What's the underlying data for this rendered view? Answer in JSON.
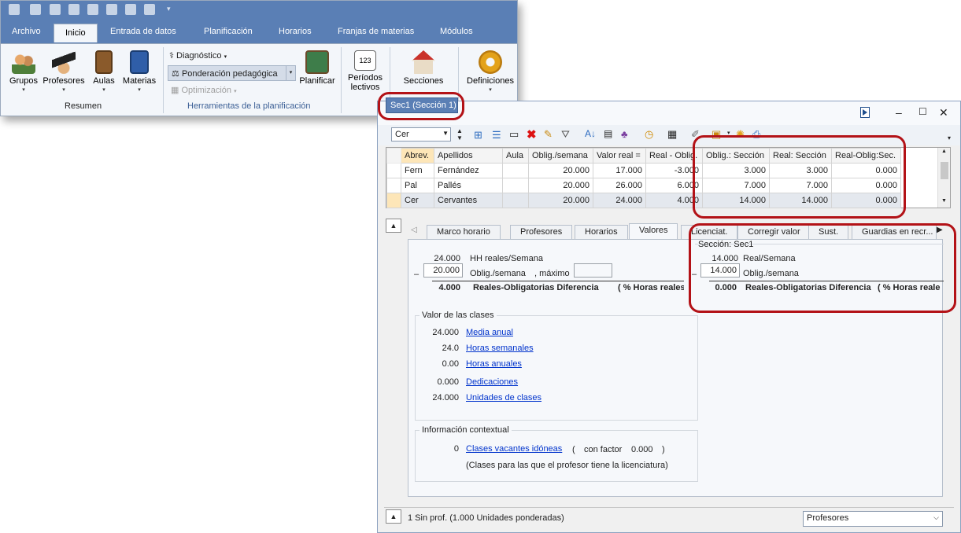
{
  "ribbon": {
    "tabs": [
      "Archivo",
      "Inicio",
      "Entrada de datos",
      "Planificación",
      "Horarios",
      "Franjas de materias",
      "Módulos"
    ],
    "active_tab": "Inicio",
    "buttons": {
      "grupos": "Grupos",
      "profesores": "Profesores",
      "aulas": "Aulas",
      "materias": "Materias",
      "diagnostico": "Diagnóstico",
      "ponderacion": "Ponderación pedagógica",
      "optimizacion": "Optimización",
      "planificar": "Planificar",
      "periodos_line1": "Períodos",
      "periodos_line2": "lectivos",
      "periodos_icon_text": "123",
      "secciones": "Secciones",
      "definiciones": "Definiciones"
    },
    "group_labels": {
      "resumen": "Resumen",
      "herramientas": "Herramientas de la planificación"
    },
    "section_dropdown": "Sec1 (Sección 1)",
    "dropdown_ghost": "Profesores"
  },
  "window": {
    "teacher_combo": "Cer",
    "grid": {
      "headers": [
        "Abrev.",
        "Apellidos",
        "Aula",
        "Oblig./semana",
        "Valor real =",
        "Real - Oblig.",
        "Oblig.: Sección",
        "Real: Sección",
        "Real-Oblig:Sec."
      ],
      "rows": [
        [
          "Fern",
          "Fernández",
          "",
          "20.000",
          "17.000",
          "-3.000",
          "3.000",
          "3.000",
          "0.000"
        ],
        [
          "Pal",
          "Pallés",
          "",
          "20.000",
          "26.000",
          "6.000",
          "7.000",
          "7.000",
          "0.000"
        ],
        [
          "Cer",
          "Cervantes",
          "",
          "20.000",
          "24.000",
          "4.000",
          "14.000",
          "14.000",
          "0.000"
        ]
      ]
    },
    "tabs": [
      "Marco horario",
      "Profesores",
      "Horarios",
      "Valores",
      "Licenciat.",
      "Corregir valor",
      "Sust.",
      "Guardias en recr..."
    ],
    "active_tab": "Valores",
    "valores": {
      "hh_reales_val": "24.000",
      "hh_reales_label": "HH reales/Semana",
      "minus": "–",
      "oblig_val": "20.000",
      "oblig_label": "Oblig./semana",
      "maximo_label": ", máximo",
      "maximo_val": "",
      "diff_val": "4.000",
      "diff_label": "Reales-Obligatorias Diferencia",
      "pct_label": "( % Horas reales:",
      "section_title": "Sección: Sec1",
      "sec_real_val": "14.000",
      "sec_real_label": "Real/Semana",
      "sec_oblig_val": "14.000",
      "sec_oblig_label": "Oblig./semana",
      "sec_diff_val": "0.000",
      "sec_diff_label": "Reales-Obligatorias Diferencia",
      "sec_pct_label": "( % Horas reale"
    },
    "valor_clases": {
      "title": "Valor de las clases",
      "items": [
        {
          "value": "24.000",
          "label": "Media anual"
        },
        {
          "value": "24.0",
          "label": "Horas semanales"
        },
        {
          "value": "0.00",
          "label": "Horas anuales"
        },
        {
          "value": "0.000",
          "label": "Dedicaciones"
        },
        {
          "value": "24.000",
          "label": "Unidades de clases"
        }
      ]
    },
    "contextual": {
      "title": "Información contextual",
      "count": "0",
      "link": "Clases vacantes idóneas",
      "factor_open": "(",
      "factor_label": "con factor",
      "factor_value": "0.000",
      "factor_close": ")",
      "note": "(Clases para las que el profesor tiene la licenciatura)"
    },
    "status_text": "1 Sin prof. (1.000 Unidades ponderadas)",
    "view_combo": "Profesores"
  },
  "colors": {
    "ribbon_blue": "#5a7fb5",
    "highlight_red": "#b31217",
    "link_blue": "#0033cc",
    "group_label_blue": "#3b5f95"
  }
}
